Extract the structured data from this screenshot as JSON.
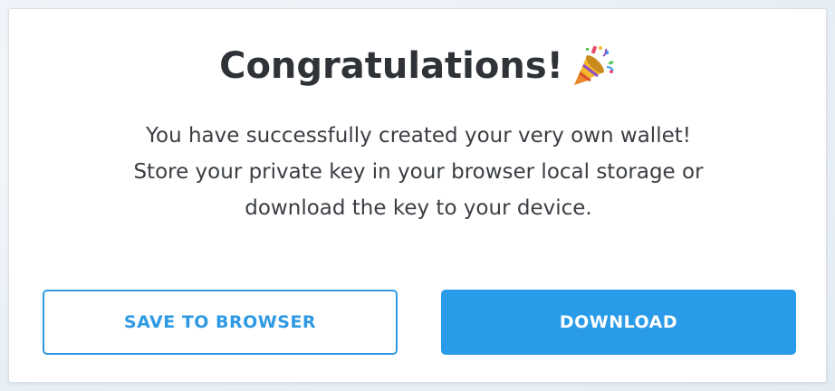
{
  "dialog": {
    "title": "Congratulations!",
    "title_icon": "party-popper-icon",
    "message_lines": [
      "You have successfully created your very own wallet!",
      "Store your private key in your browser local storage or",
      "download the key to your device."
    ]
  },
  "actions": {
    "save_label": "SAVE TO BROWSER",
    "download_label": "DOWNLOAD"
  },
  "colors": {
    "accent": "#2a9be8",
    "title_text": "#2f3338",
    "body_text": "#3a3e43"
  }
}
